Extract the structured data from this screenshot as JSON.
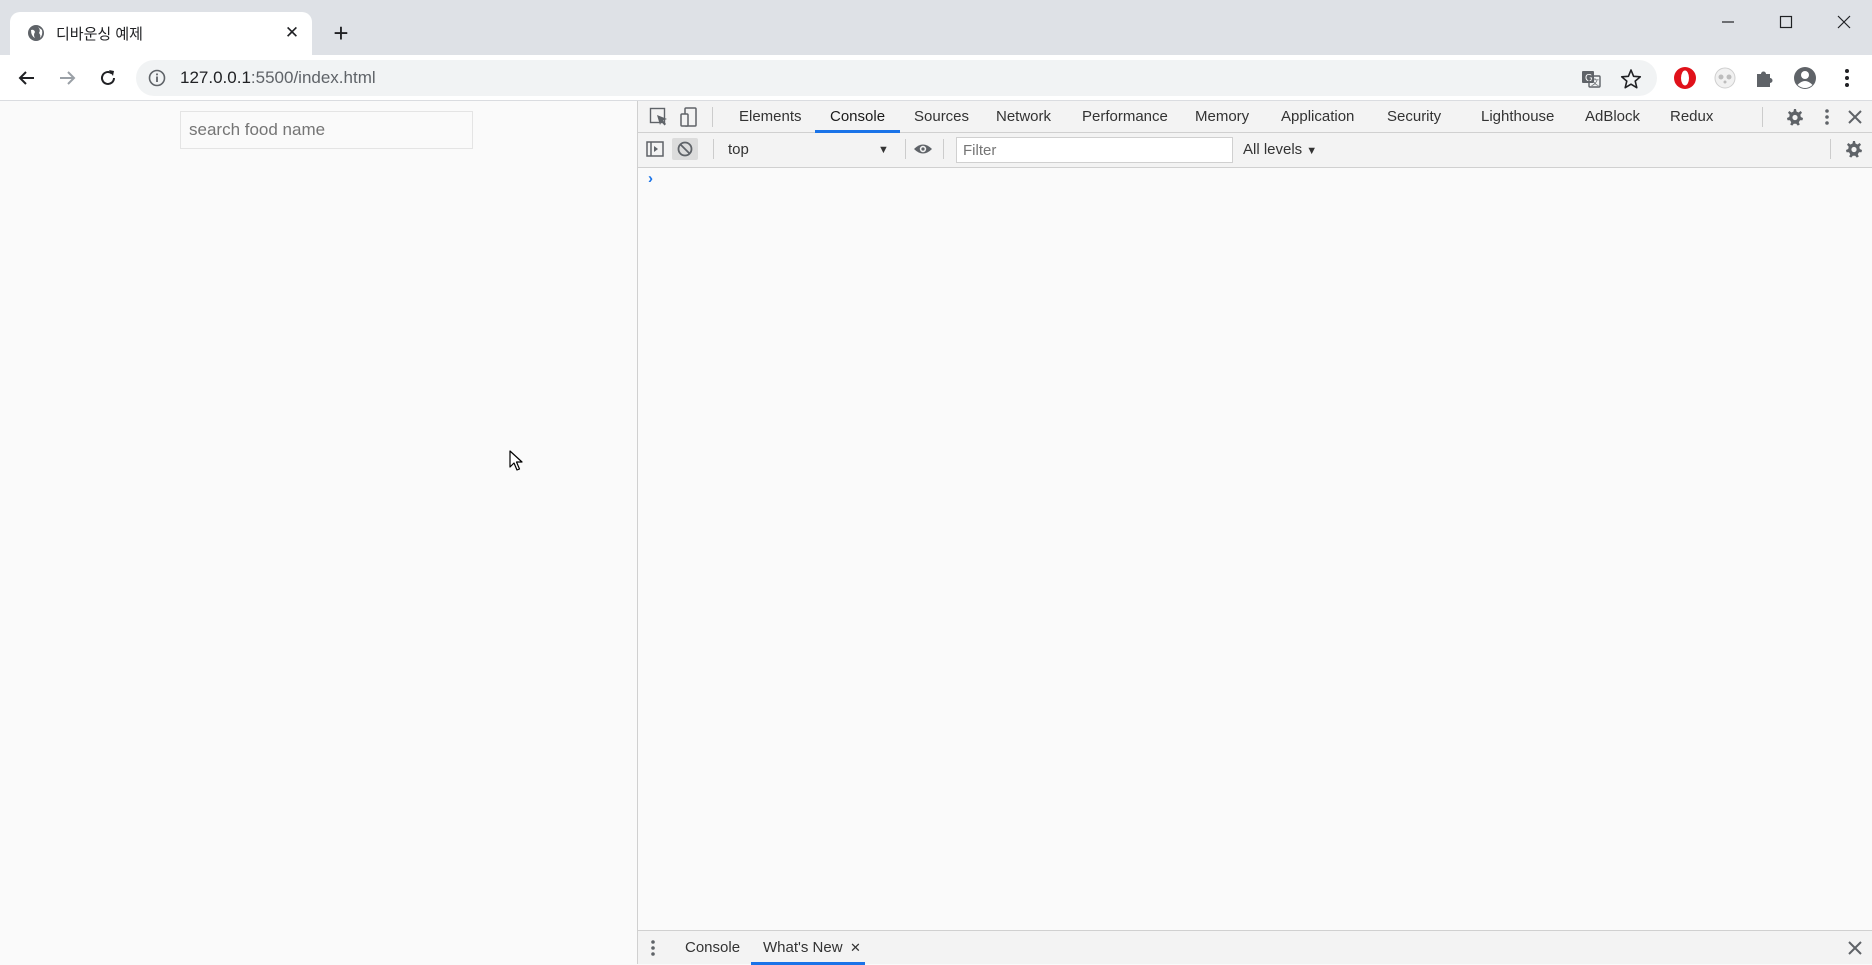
{
  "browser": {
    "tab": {
      "title": "디바운싱 예제",
      "close_label": "✕"
    },
    "new_tab_label": "+",
    "address": {
      "url_host": "127.0.0.1",
      "url_rest": ":5500/index.html"
    }
  },
  "page": {
    "search": {
      "placeholder": "search food name",
      "value": ""
    }
  },
  "devtools": {
    "tabs": [
      "Elements",
      "Console",
      "Sources",
      "Network",
      "Performance",
      "Memory",
      "Application",
      "Security",
      "Lighthouse",
      "AdBlock",
      "Redux"
    ],
    "active_tab": "Console",
    "console": {
      "context": "top",
      "filter_placeholder": "Filter",
      "levels": "All levels",
      "prompt": "›"
    },
    "drawer": {
      "tabs": [
        "Console",
        "What's New"
      ],
      "active_tab": "What's New",
      "close_label": "✕"
    }
  },
  "colors": {
    "accent": "#1a73e8",
    "tabstrip": "#dee1e6",
    "opera_red": "#e0111a"
  }
}
